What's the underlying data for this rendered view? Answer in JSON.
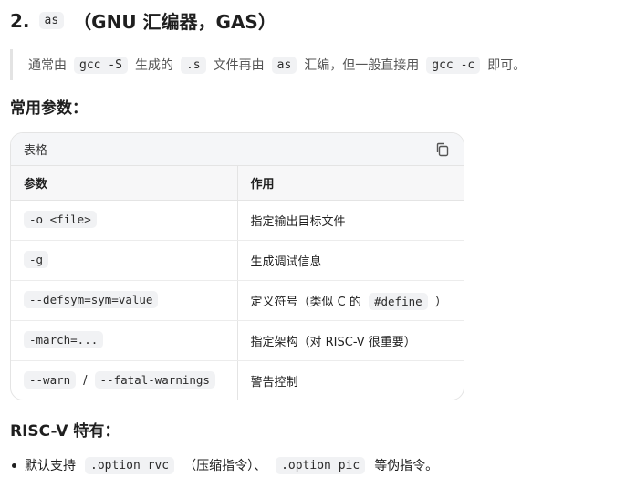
{
  "heading": {
    "prefix": "2.",
    "code": "as",
    "rest": "（GNU 汇编器，GAS）"
  },
  "quote": {
    "t1": "通常由",
    "c1": "gcc -S",
    "t2": "生成的",
    "c2": ".s",
    "t3": "文件再由",
    "c3": "as",
    "t4": "汇编，但一般直接用",
    "c4": "gcc -c",
    "t5": "即可。"
  },
  "params_heading": "常用参数：",
  "table": {
    "label": "表格",
    "copy_icon": "copy-icon",
    "headers": [
      "参数",
      "作用"
    ],
    "rows": [
      {
        "param": "-o <file>",
        "desc": "指定输出目标文件"
      },
      {
        "param": "-g",
        "desc": "生成调试信息"
      },
      {
        "param": "--defsym=sym=value",
        "desc_a": "定义符号（类似 C 的",
        "desc_code": "#define",
        "desc_b": "）"
      },
      {
        "param": "-march=...",
        "desc": "指定架构（对 RISC-V 很重要）"
      },
      {
        "param_a": "--warn",
        "param_sep": "/",
        "param_b": "--fatal-warnings",
        "desc": "警告控制"
      }
    ]
  },
  "riscv_heading": "RISC-V 特有：",
  "bullet": {
    "t1": "默认支持",
    "c1": ".option rvc",
    "t2": "（压缩指令）、",
    "c2": ".option pic",
    "t3": "等伪指令。"
  }
}
